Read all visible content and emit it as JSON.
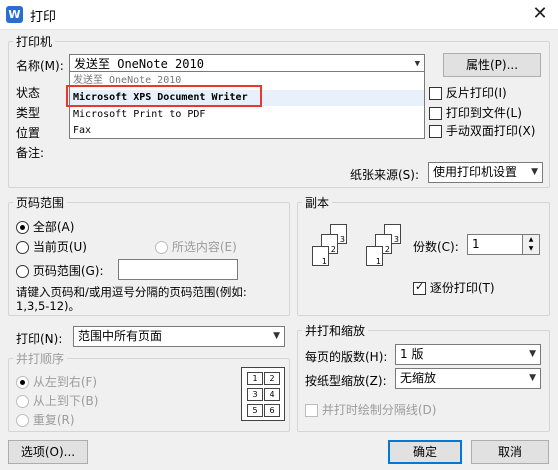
{
  "window": {
    "title": "打印",
    "app_icon_letter": "W"
  },
  "printer": {
    "group_label": "打印机",
    "name_label": "名称(M):",
    "name_value": "发送至 OneNote 2010",
    "properties_button": "属性(P)...",
    "status_label": "状态",
    "type_label": "类型",
    "location_label": "位置",
    "comment_label": "备注:",
    "dropdown_options": [
      "发送至 OneNote 2010",
      "Microsoft XPS Document Writer",
      "Microsoft Print to PDF",
      "Fax"
    ],
    "reverse_print": "反片打印(I)",
    "print_to_file": "打印到文件(L)",
    "manual_duplex": "手动双面打印(X)",
    "paper_source_label": "纸张来源(S):",
    "paper_source_value": "使用打印机设置"
  },
  "page_range": {
    "group_label": "页码范围",
    "all": "全部(A)",
    "current": "当前页(U)",
    "selection": "所选内容(E)",
    "pages": "页码范围(G):",
    "pages_value": "",
    "hint_line1": "请键入页码和/或用逗号分隔的页码范围(例如:",
    "hint_line2": "1,3,5-12)。"
  },
  "copies": {
    "group_label": "副本",
    "count_label": "份数(C):",
    "count_value": "1",
    "collate": "逐份打印(T)"
  },
  "print_what": {
    "label": "打印(N):",
    "value": "范围中所有页面"
  },
  "order": {
    "group_label": "并打顺序",
    "left_to_right": "从左到右(F)",
    "top_to_bottom": "从上到下(B)",
    "repeat": "重复(R)",
    "grid": [
      "1",
      "2",
      "3",
      "4",
      "5",
      "6"
    ]
  },
  "zoom": {
    "group_label": "并打和缩放",
    "pages_per_sheet_label": "每页的版数(H):",
    "pages_per_sheet_value": "1 版",
    "scale_label": "按纸型缩放(Z):",
    "scale_value": "无缩放",
    "draw_borders": "并打时绘制分隔线(D)"
  },
  "buttons": {
    "options": "选项(O)...",
    "ok": "确定",
    "cancel": "取消"
  }
}
